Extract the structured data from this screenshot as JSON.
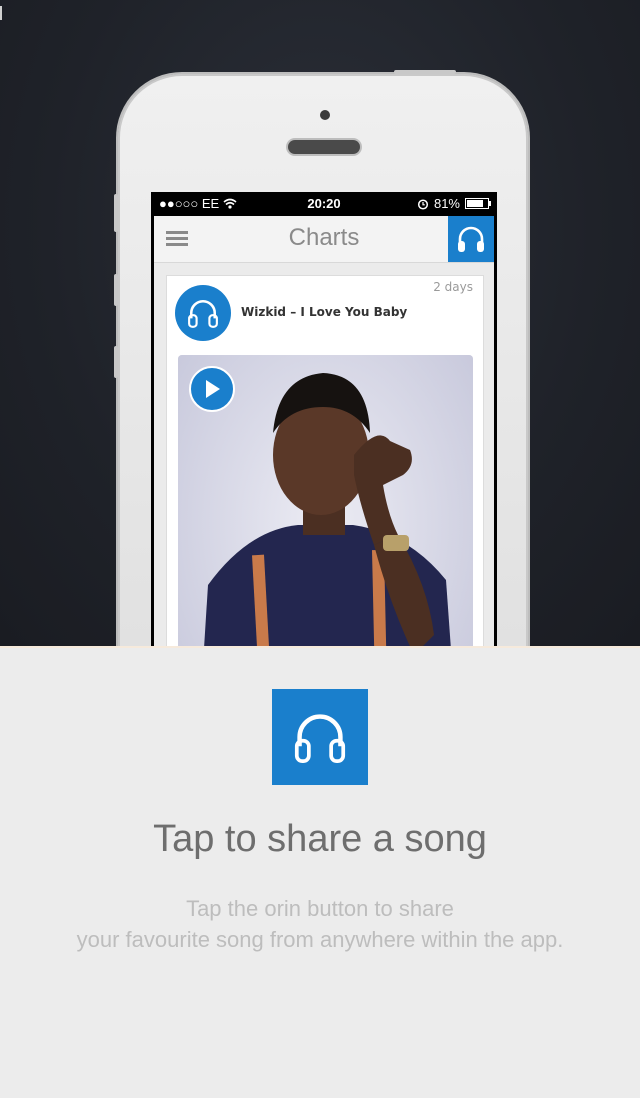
{
  "colors": {
    "accent": "#1a7fcc",
    "panel_bg": "#ececec",
    "backdrop": "#1f2229"
  },
  "status_bar": {
    "carrier": "●●○○○ EE",
    "time": "20:20",
    "battery_percent": "81%",
    "battery_level": 0.81,
    "icons": [
      "wifi-icon",
      "alarm-icon",
      "battery-icon"
    ]
  },
  "navbar": {
    "title": "Charts",
    "menu_icon": "hamburger-icon",
    "share_icon": "headphones-icon"
  },
  "post": {
    "time_ago": "2 days",
    "title": "Wizkid – I Love You Baby",
    "avatar_icon": "headphones-icon",
    "play_icon": "play-icon"
  },
  "onboarding": {
    "icon": "headphones-icon",
    "headline": "Tap to share a song",
    "description_line1": "Tap the orin button to share",
    "description_line2": "your favourite song from anywhere within the app."
  }
}
